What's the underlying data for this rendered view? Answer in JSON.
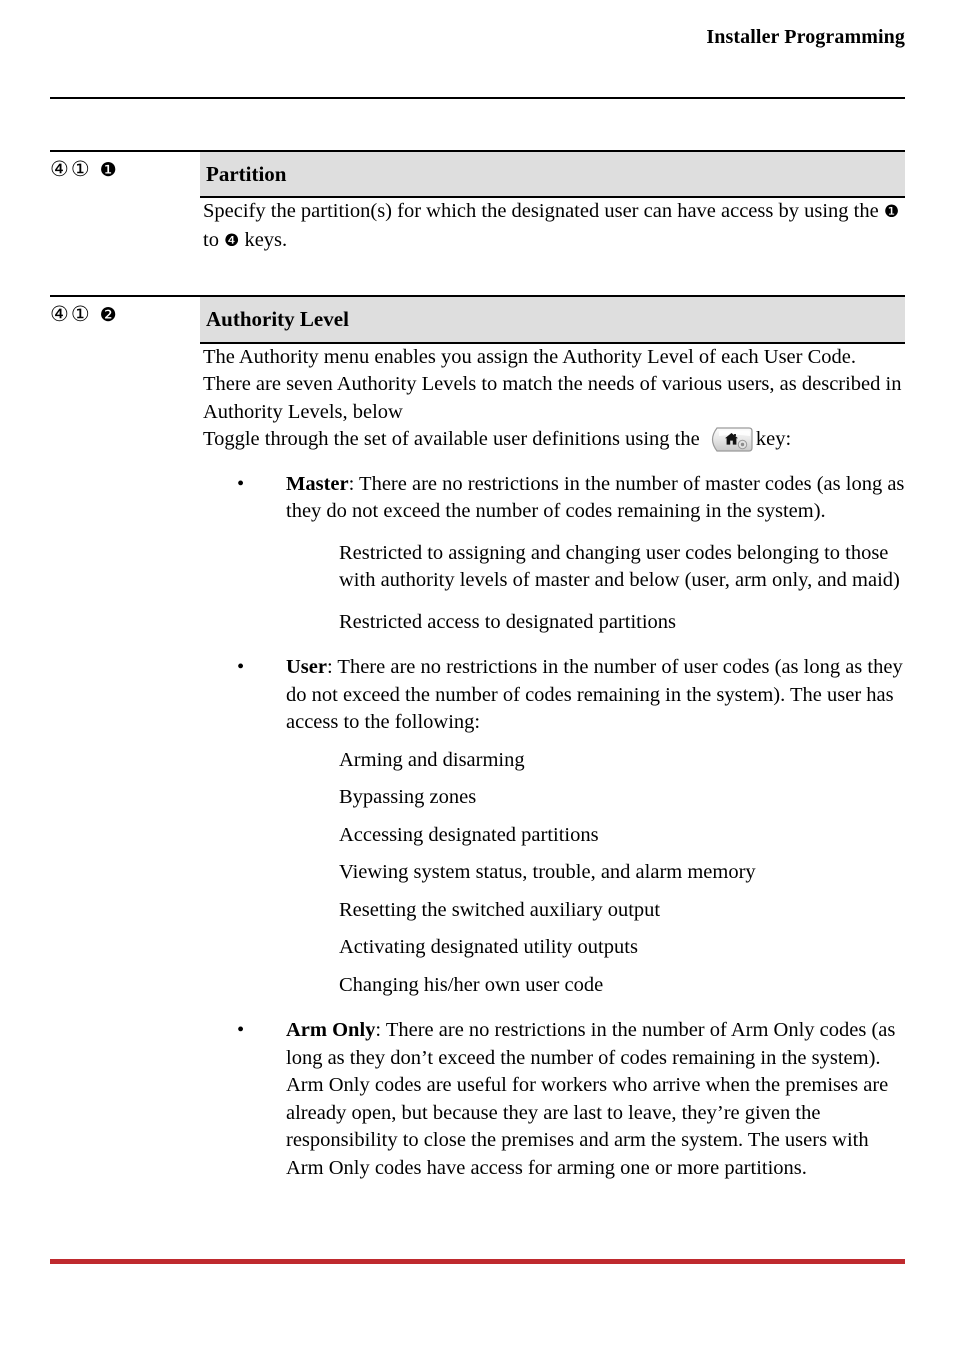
{
  "header": {
    "title": "Installer Programming"
  },
  "icons": {
    "circled_four": "④",
    "circled_one": "①",
    "neg_one": "❶",
    "neg_two": "❷",
    "neg_four": "❹",
    "bullet": "•",
    "key_icon_name": "home-key-icon"
  },
  "colors": {
    "heading_band": "#dedede",
    "footer_rule": "#bf2a2e",
    "rule": "#000000",
    "text": "#000000"
  },
  "sections": [
    {
      "keypath": {
        "step1": "④",
        "step2": "①",
        "step3": "❶"
      },
      "heading": "Partition",
      "paragraphs": [
        {
          "pre": "Specify the partition(s) for which the designated user can have access by using the ",
          "sym1": "❶",
          "mid": " to ",
          "sym2": "❹",
          "post": " keys."
        }
      ]
    },
    {
      "keypath": {
        "step1": "④",
        "step2": "①",
        "step3": "❷"
      },
      "heading": "Authority Level",
      "intro": "The Authority menu enables you assign the Authority Level of each User Code. There are seven Authority Levels to match the needs of various users, as described in Authority Levels, below",
      "toggle": {
        "pre": "Toggle through the set of available user definitions using the ",
        "post": "key:"
      },
      "bullets": [
        {
          "label": "Master",
          "text": ": There are no restrictions in the number of master codes (as long as they do not exceed the number of codes remaining in the system).",
          "subitems": [
            "Restricted to assigning and changing user codes belonging to those with authority levels of master and below (user, arm only, and maid)",
            "Restricted access to designated partitions"
          ]
        },
        {
          "label": "User",
          "text": ": There are no restrictions in the number of user codes (as long as they do not exceed the number of codes remaining in the system). The user has access to the following:",
          "subitems": [
            "Arming and disarming",
            "Bypassing zones",
            "Accessing designated partitions",
            "Viewing system status, trouble, and alarm memory",
            "Resetting the switched auxiliary output",
            "Activating designated utility outputs",
            "Changing his/her own user code"
          ]
        },
        {
          "label": "Arm Only",
          "text": ": There are no restrictions in the number of Arm Only codes (as long as they don’t exceed the number of codes remaining in the system). Arm Only codes are useful for workers who arrive when the premises are already open, but because they are last to leave, they’re given the responsibility to close the premises and arm the system. The users with Arm Only codes have access for arming one or more partitions.",
          "subitems": []
        }
      ]
    }
  ]
}
